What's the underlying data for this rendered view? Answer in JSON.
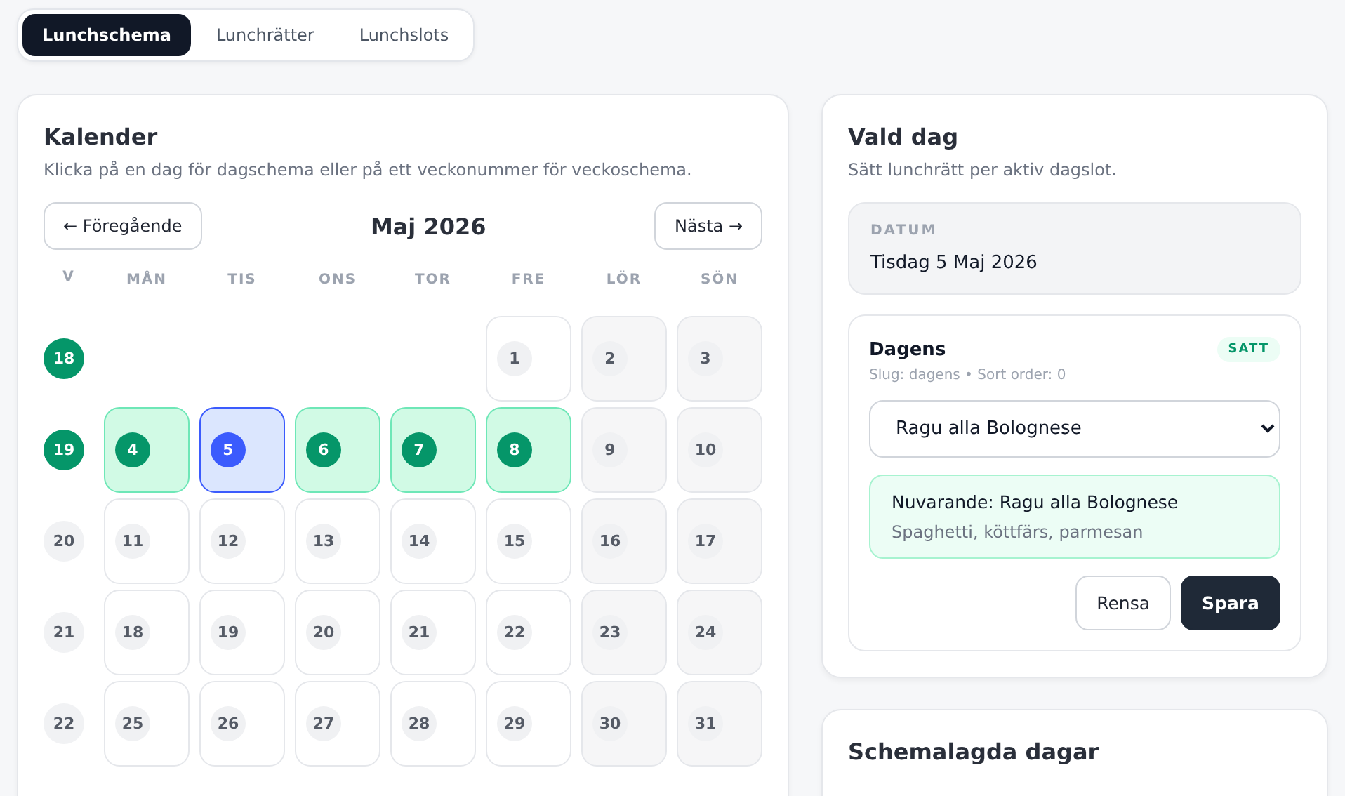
{
  "tabs": [
    {
      "label": "Lunchschema",
      "selected": true
    },
    {
      "label": "Lunchrätter",
      "selected": false
    },
    {
      "label": "Lunchslots",
      "selected": false
    }
  ],
  "calendar": {
    "title": "Kalender",
    "subtitle": "Klicka på en dag för dagschema eller på ett veckonummer för veckoschema.",
    "prev": "← Föregående",
    "month": "Maj 2026",
    "next": "Nästa →",
    "week_header": "V",
    "weekdays": [
      "MÅN",
      "TIS",
      "ONS",
      "TOR",
      "FRE",
      "LÖR",
      "SÖN"
    ],
    "weeks": [
      {
        "number": "18",
        "scheduled": true,
        "days": [
          {
            "kind": "blank"
          },
          {
            "kind": "blank"
          },
          {
            "kind": "blank"
          },
          {
            "kind": "blank"
          },
          {
            "kind": "weekday",
            "label": "1",
            "scheduled": false,
            "selected": false
          },
          {
            "kind": "weekend",
            "label": "2",
            "scheduled": false,
            "selected": false
          },
          {
            "kind": "weekend",
            "label": "3",
            "scheduled": false,
            "selected": false
          }
        ]
      },
      {
        "number": "19",
        "scheduled": true,
        "days": [
          {
            "kind": "weekday",
            "label": "4",
            "scheduled": true,
            "selected": false
          },
          {
            "kind": "weekday",
            "label": "5",
            "scheduled": true,
            "selected": true
          },
          {
            "kind": "weekday",
            "label": "6",
            "scheduled": true,
            "selected": false
          },
          {
            "kind": "weekday",
            "label": "7",
            "scheduled": true,
            "selected": false
          },
          {
            "kind": "weekday",
            "label": "8",
            "scheduled": true,
            "selected": false
          },
          {
            "kind": "weekend",
            "label": "9",
            "scheduled": false,
            "selected": false
          },
          {
            "kind": "weekend",
            "label": "10",
            "scheduled": false,
            "selected": false
          }
        ]
      },
      {
        "number": "20",
        "scheduled": false,
        "days": [
          {
            "kind": "weekday",
            "label": "11",
            "scheduled": false,
            "selected": false
          },
          {
            "kind": "weekday",
            "label": "12",
            "scheduled": false,
            "selected": false
          },
          {
            "kind": "weekday",
            "label": "13",
            "scheduled": false,
            "selected": false
          },
          {
            "kind": "weekday",
            "label": "14",
            "scheduled": false,
            "selected": false
          },
          {
            "kind": "weekday",
            "label": "15",
            "scheduled": false,
            "selected": false
          },
          {
            "kind": "weekend",
            "label": "16",
            "scheduled": false,
            "selected": false
          },
          {
            "kind": "weekend",
            "label": "17",
            "scheduled": false,
            "selected": false
          }
        ]
      },
      {
        "number": "21",
        "scheduled": false,
        "days": [
          {
            "kind": "weekday",
            "label": "18",
            "scheduled": false,
            "selected": false
          },
          {
            "kind": "weekday",
            "label": "19",
            "scheduled": false,
            "selected": false
          },
          {
            "kind": "weekday",
            "label": "20",
            "scheduled": false,
            "selected": false
          },
          {
            "kind": "weekday",
            "label": "21",
            "scheduled": false,
            "selected": false
          },
          {
            "kind": "weekday",
            "label": "22",
            "scheduled": false,
            "selected": false
          },
          {
            "kind": "weekend",
            "label": "23",
            "scheduled": false,
            "selected": false
          },
          {
            "kind": "weekend",
            "label": "24",
            "scheduled": false,
            "selected": false
          }
        ]
      },
      {
        "number": "22",
        "scheduled": false,
        "days": [
          {
            "kind": "weekday",
            "label": "25",
            "scheduled": false,
            "selected": false
          },
          {
            "kind": "weekday",
            "label": "26",
            "scheduled": false,
            "selected": false
          },
          {
            "kind": "weekday",
            "label": "27",
            "scheduled": false,
            "selected": false
          },
          {
            "kind": "weekday",
            "label": "28",
            "scheduled": false,
            "selected": false
          },
          {
            "kind": "weekday",
            "label": "29",
            "scheduled": false,
            "selected": false
          },
          {
            "kind": "weekend",
            "label": "30",
            "scheduled": false,
            "selected": false
          },
          {
            "kind": "weekend",
            "label": "31",
            "scheduled": false,
            "selected": false
          }
        ]
      }
    ]
  },
  "selected_day": {
    "title": "Vald dag",
    "subtitle": "Sätt lunchrätt per aktiv dagslot.",
    "date_label": "DATUM",
    "date": "Tisdag 5 Maj 2026",
    "slot": {
      "name": "Dagens",
      "badge": "SATT",
      "meta": "Slug: dagens • Sort order: 0",
      "dish": "Ragu alla Bolognese",
      "current_title": "Nuvarande: Ragu alla Bolognese",
      "current_desc": "Spaghetti, köttfärs, parmesan",
      "clear": "Rensa",
      "save": "Spara"
    }
  },
  "scheduled_days": {
    "title": "Schemalagda dagar"
  }
}
